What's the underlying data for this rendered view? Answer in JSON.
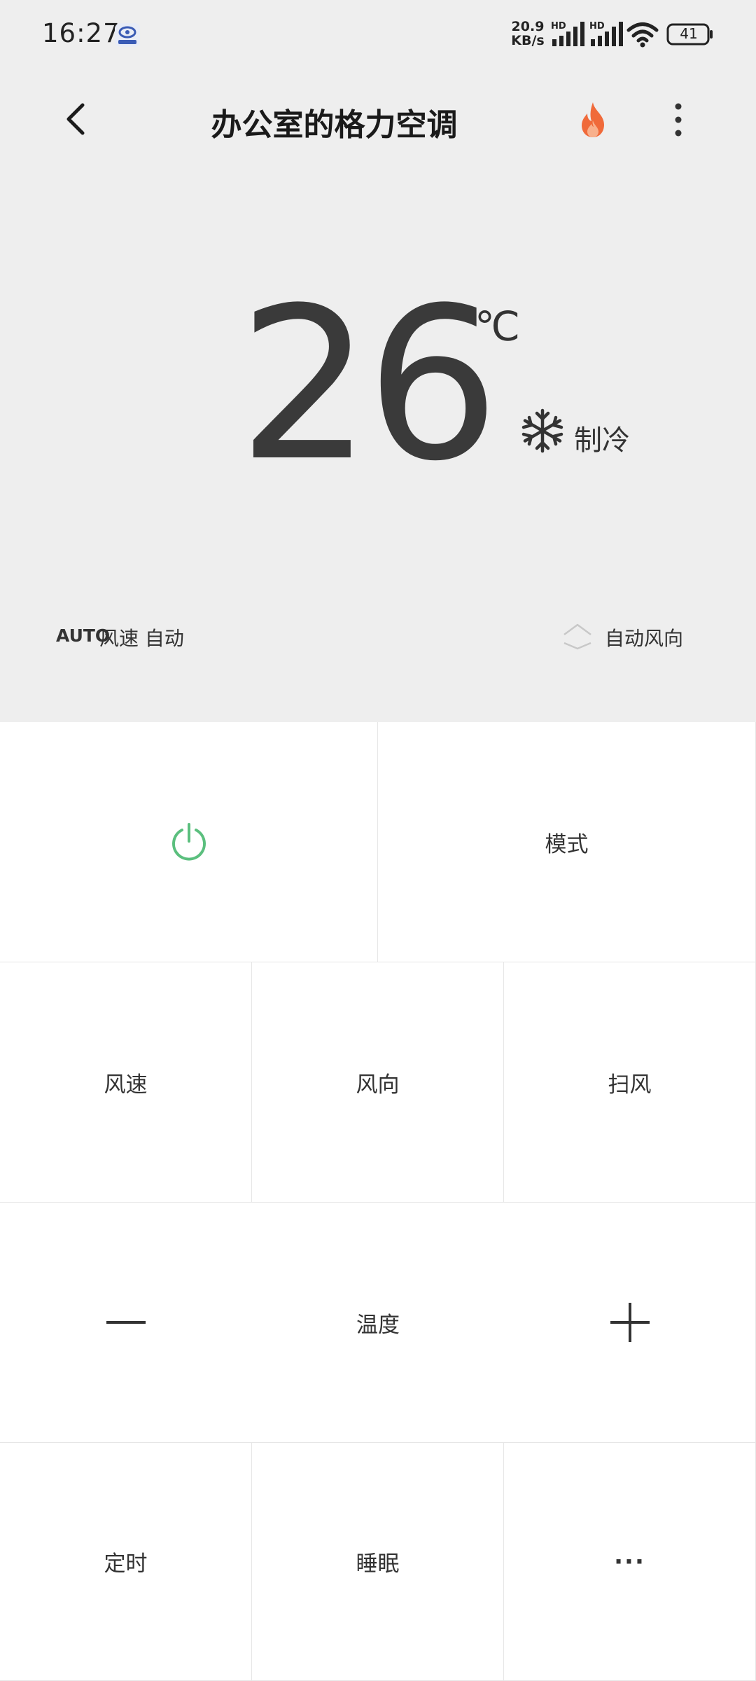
{
  "status_bar": {
    "time": "16:27",
    "net_speed_value": "20.9",
    "net_speed_unit": "KB/s",
    "battery": "41",
    "signal_1_label": "HD",
    "signal_2_label": "HD"
  },
  "header": {
    "title": "办公室的格力空调"
  },
  "display": {
    "temperature": "26",
    "unit": "℃",
    "mode": "制冷",
    "fan_tag": "AUTO",
    "fan_text": "风速 自动",
    "swing_text": "自动风向"
  },
  "controls": {
    "mode": "模式",
    "fan_speed": "风速",
    "fan_direction": "风向",
    "sweep": "扫风",
    "temperature": "温度",
    "timer": "定时",
    "sleep": "睡眠",
    "more": "···"
  },
  "colors": {
    "power_green": "#5bbf7e",
    "fire_orange": "#f06a3a",
    "top_background": "#eeeeee"
  }
}
